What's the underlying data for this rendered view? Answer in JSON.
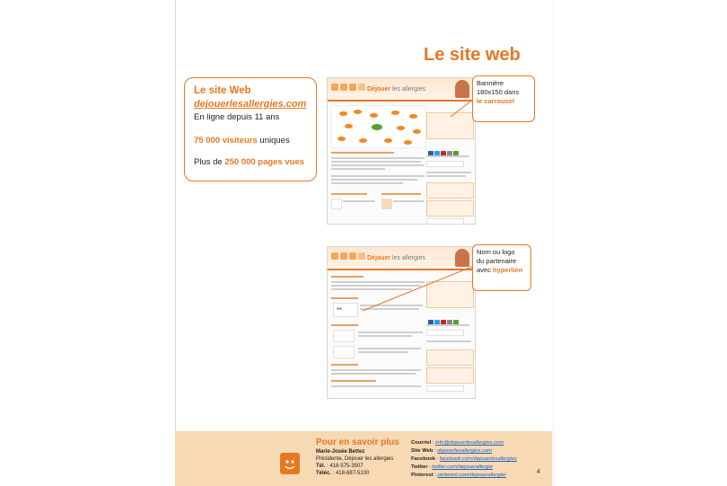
{
  "heading": "Le site web",
  "infobox": {
    "title": "Le site Web",
    "url": "dejouerlesallergies.com",
    "online_since": "En ligne depuis 11 ans",
    "visitors_num": "75 000 visiteurs",
    "visitors_rest": " uniques",
    "pages_pre": "Plus de ",
    "pages_num": "250 000 pages vues"
  },
  "screenshot1": {
    "site_name": "Déjouer",
    "site_name2": " les allergies"
  },
  "screenshot2": {
    "site_name": "Déjouer",
    "site_name2": " les allergies"
  },
  "callout1": {
    "line1": "Bannière",
    "line2": "180x150 dans",
    "line3": "le carrousel"
  },
  "callout2": {
    "line1": "Nom ou logo",
    "line2": "du partenaire",
    "line3_pre": "avec ",
    "line3_hl": "hyperlien"
  },
  "footer": {
    "title": "Pour en savoir plus",
    "name": "Marie-Josée Bettez",
    "role": "Présidente, Déjouer les allergies",
    "tel_label": "Tél.",
    "tel": " : 418-575-3507",
    "fax_label": "Téléc.",
    "fax": " : 418-687-5100",
    "email_label": "Courriel",
    "email": "info@dejouerlesallergies.com",
    "web_label": "Site Web",
    "web": "dejouerlesallergies.com",
    "fb_label": "Facebook",
    "fb": "facebook.com/dejouerlesallergies",
    "tw_label": "Twitter",
    "tw": "twitter.com/dejouerallergie",
    "pin_label": "Pinterest",
    "pin": "pinterest.com/dejouerallergie/"
  },
  "page_number": "4",
  "colors": {
    "accent": "#e87722",
    "footer_bg": "#f7d9b4"
  }
}
